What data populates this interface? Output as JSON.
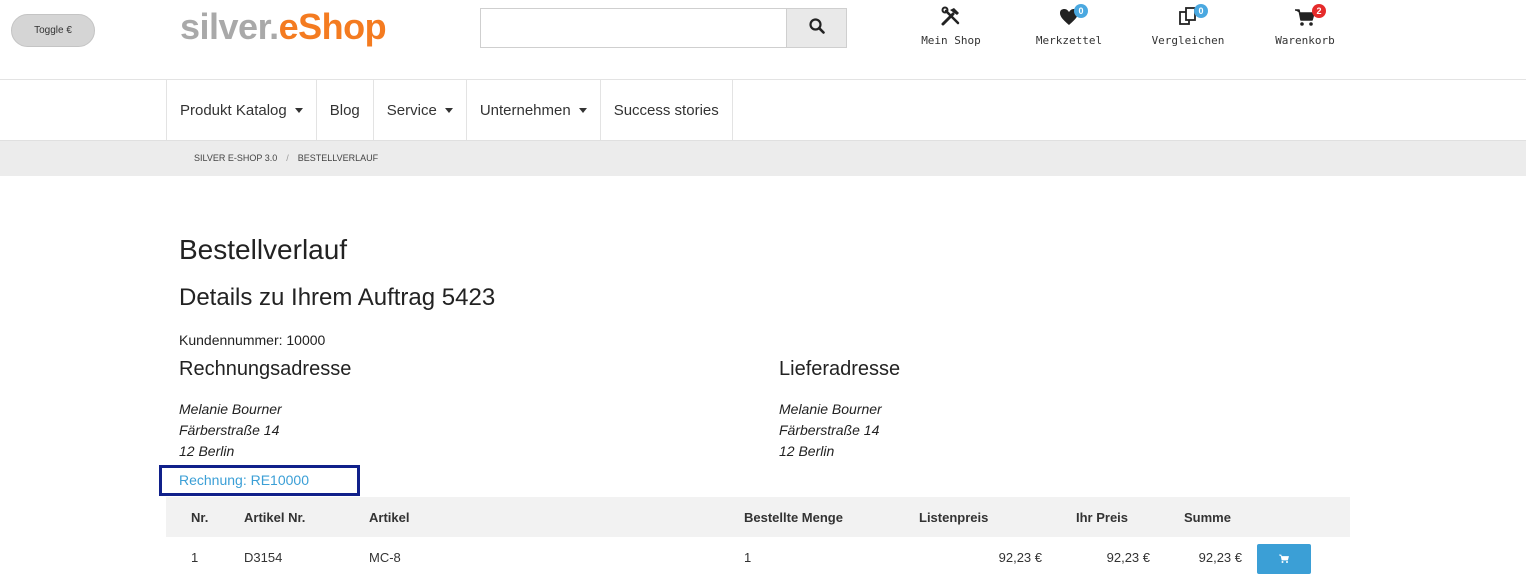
{
  "header": {
    "toggle_label": "Toggle €",
    "logo_part1": "silver.",
    "logo_part2": "eShop",
    "search": {
      "value": "",
      "placeholder": ""
    },
    "icons": [
      {
        "label": "Mein Shop",
        "icon": "tools-icon"
      },
      {
        "label": "Merkzettel",
        "icon": "heart-icon",
        "count": "0"
      },
      {
        "label": "Vergleichen",
        "icon": "compare-icon",
        "count": "0"
      },
      {
        "label": "Warenkorb",
        "icon": "cart-icon",
        "count": "2"
      }
    ]
  },
  "nav": {
    "items": [
      {
        "label": "Produkt Katalog"
      },
      {
        "label": "Blog"
      },
      {
        "label": "Service"
      },
      {
        "label": "Unternehmen"
      },
      {
        "label": "Success stories"
      }
    ]
  },
  "breadcrumb": {
    "home": "SILVER E-SHOP 3.0",
    "separator": "/",
    "current": "BESTELLVERLAUF"
  },
  "main": {
    "title": "Bestellverlauf",
    "subtitle": "Details zu Ihrem Auftrag 5423",
    "customer_number": "Kundennummer: 10000",
    "billing": {
      "heading": "Rechnungsadresse",
      "name": "Melanie Bourner",
      "street": "Färberstraße 14",
      "city": "12 Berlin"
    },
    "shipping": {
      "heading": "Lieferadresse",
      "name": "Melanie Bourner",
      "street": "Färberstraße 14",
      "city": "12 Berlin"
    },
    "invoice_link": "Rechnung: RE10000"
  },
  "table": {
    "headers": [
      "Nr.",
      "Artikel Nr.",
      "Artikel",
      "Bestellte Menge",
      "Listenpreis",
      "Ihr Preis",
      "Summe"
    ],
    "rows": [
      [
        "1",
        "D3154",
        "MC-8",
        "1",
        "92,23 €",
        "92,23 €",
        "92,23 €"
      ]
    ]
  },
  "colors": {
    "brand_orange": "#f47b20",
    "logo_gray": "#a9a9a9",
    "accent_blue": "#3b9fd6",
    "badge_red": "#e52b2b",
    "highlight_border": "#10208a"
  }
}
